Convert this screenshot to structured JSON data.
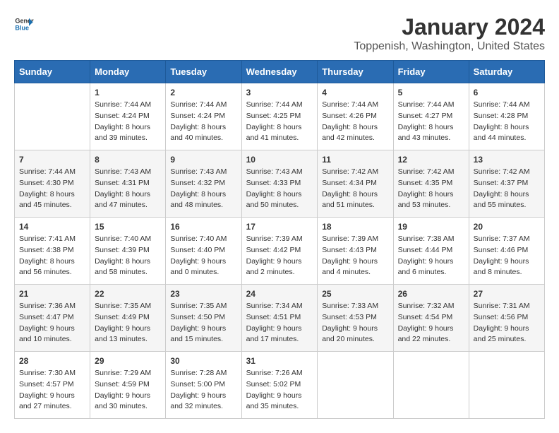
{
  "header": {
    "logo_general": "General",
    "logo_blue": "Blue",
    "month_year": "January 2024",
    "location": "Toppenish, Washington, United States"
  },
  "columns": [
    "Sunday",
    "Monday",
    "Tuesday",
    "Wednesday",
    "Thursday",
    "Friday",
    "Saturday"
  ],
  "weeks": [
    [
      {
        "day": "",
        "info": ""
      },
      {
        "day": "1",
        "info": "Sunrise: 7:44 AM\nSunset: 4:24 PM\nDaylight: 8 hours\nand 39 minutes."
      },
      {
        "day": "2",
        "info": "Sunrise: 7:44 AM\nSunset: 4:24 PM\nDaylight: 8 hours\nand 40 minutes."
      },
      {
        "day": "3",
        "info": "Sunrise: 7:44 AM\nSunset: 4:25 PM\nDaylight: 8 hours\nand 41 minutes."
      },
      {
        "day": "4",
        "info": "Sunrise: 7:44 AM\nSunset: 4:26 PM\nDaylight: 8 hours\nand 42 minutes."
      },
      {
        "day": "5",
        "info": "Sunrise: 7:44 AM\nSunset: 4:27 PM\nDaylight: 8 hours\nand 43 minutes."
      },
      {
        "day": "6",
        "info": "Sunrise: 7:44 AM\nSunset: 4:28 PM\nDaylight: 8 hours\nand 44 minutes."
      }
    ],
    [
      {
        "day": "7",
        "info": "Sunrise: 7:44 AM\nSunset: 4:30 PM\nDaylight: 8 hours\nand 45 minutes."
      },
      {
        "day": "8",
        "info": "Sunrise: 7:43 AM\nSunset: 4:31 PM\nDaylight: 8 hours\nand 47 minutes."
      },
      {
        "day": "9",
        "info": "Sunrise: 7:43 AM\nSunset: 4:32 PM\nDaylight: 8 hours\nand 48 minutes."
      },
      {
        "day": "10",
        "info": "Sunrise: 7:43 AM\nSunset: 4:33 PM\nDaylight: 8 hours\nand 50 minutes."
      },
      {
        "day": "11",
        "info": "Sunrise: 7:42 AM\nSunset: 4:34 PM\nDaylight: 8 hours\nand 51 minutes."
      },
      {
        "day": "12",
        "info": "Sunrise: 7:42 AM\nSunset: 4:35 PM\nDaylight: 8 hours\nand 53 minutes."
      },
      {
        "day": "13",
        "info": "Sunrise: 7:42 AM\nSunset: 4:37 PM\nDaylight: 8 hours\nand 55 minutes."
      }
    ],
    [
      {
        "day": "14",
        "info": "Sunrise: 7:41 AM\nSunset: 4:38 PM\nDaylight: 8 hours\nand 56 minutes."
      },
      {
        "day": "15",
        "info": "Sunrise: 7:40 AM\nSunset: 4:39 PM\nDaylight: 8 hours\nand 58 minutes."
      },
      {
        "day": "16",
        "info": "Sunrise: 7:40 AM\nSunset: 4:40 PM\nDaylight: 9 hours\nand 0 minutes."
      },
      {
        "day": "17",
        "info": "Sunrise: 7:39 AM\nSunset: 4:42 PM\nDaylight: 9 hours\nand 2 minutes."
      },
      {
        "day": "18",
        "info": "Sunrise: 7:39 AM\nSunset: 4:43 PM\nDaylight: 9 hours\nand 4 minutes."
      },
      {
        "day": "19",
        "info": "Sunrise: 7:38 AM\nSunset: 4:44 PM\nDaylight: 9 hours\nand 6 minutes."
      },
      {
        "day": "20",
        "info": "Sunrise: 7:37 AM\nSunset: 4:46 PM\nDaylight: 9 hours\nand 8 minutes."
      }
    ],
    [
      {
        "day": "21",
        "info": "Sunrise: 7:36 AM\nSunset: 4:47 PM\nDaylight: 9 hours\nand 10 minutes."
      },
      {
        "day": "22",
        "info": "Sunrise: 7:35 AM\nSunset: 4:49 PM\nDaylight: 9 hours\nand 13 minutes."
      },
      {
        "day": "23",
        "info": "Sunrise: 7:35 AM\nSunset: 4:50 PM\nDaylight: 9 hours\nand 15 minutes."
      },
      {
        "day": "24",
        "info": "Sunrise: 7:34 AM\nSunset: 4:51 PM\nDaylight: 9 hours\nand 17 minutes."
      },
      {
        "day": "25",
        "info": "Sunrise: 7:33 AM\nSunset: 4:53 PM\nDaylight: 9 hours\nand 20 minutes."
      },
      {
        "day": "26",
        "info": "Sunrise: 7:32 AM\nSunset: 4:54 PM\nDaylight: 9 hours\nand 22 minutes."
      },
      {
        "day": "27",
        "info": "Sunrise: 7:31 AM\nSunset: 4:56 PM\nDaylight: 9 hours\nand 25 minutes."
      }
    ],
    [
      {
        "day": "28",
        "info": "Sunrise: 7:30 AM\nSunset: 4:57 PM\nDaylight: 9 hours\nand 27 minutes."
      },
      {
        "day": "29",
        "info": "Sunrise: 7:29 AM\nSunset: 4:59 PM\nDaylight: 9 hours\nand 30 minutes."
      },
      {
        "day": "30",
        "info": "Sunrise: 7:28 AM\nSunset: 5:00 PM\nDaylight: 9 hours\nand 32 minutes."
      },
      {
        "day": "31",
        "info": "Sunrise: 7:26 AM\nSunset: 5:02 PM\nDaylight: 9 hours\nand 35 minutes."
      },
      {
        "day": "",
        "info": ""
      },
      {
        "day": "",
        "info": ""
      },
      {
        "day": "",
        "info": ""
      }
    ]
  ]
}
